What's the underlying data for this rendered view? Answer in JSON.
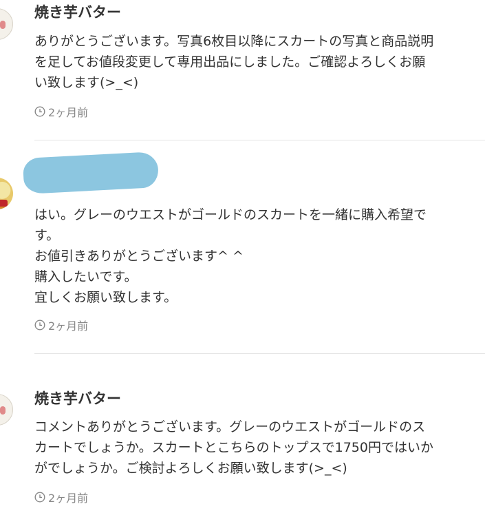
{
  "comments": [
    {
      "username": "焼き芋バター",
      "text": "ありがとうございます。写真6枚目以降にスカートの写真と商品説明\nを足してお値段変更して専用出品にしました。ご確認よろしくお願\nい致します(>_<)",
      "time": "2ヶ月前",
      "avatar_icon": "avatar-icon"
    },
    {
      "username": "",
      "text": "はい。グレーのウエストがゴールドのスカートを一緒に購入希望で\nす。\nお値引きありがとうございます^ ^\n購入したいです。\n宜しくお願い致します。",
      "time": "2ヶ月前",
      "avatar_icon": "avatar-icon"
    },
    {
      "username": "焼き芋バター",
      "text": "コメントありがとうございます。グレーのウエストがゴールドのス\nカートでしょうか。スカートとこちらのトップスで1750円ではいか\nがでしょうか。ご検討よろしくお願い致します(>_<)",
      "time": "2ヶ月前",
      "avatar_icon": "avatar-icon"
    }
  ],
  "colors": {
    "text": "#333333",
    "meta": "#888888",
    "divider": "#e5e5e5",
    "redaction": "#8cc6e0"
  },
  "icons": {
    "time": "clock-icon"
  }
}
